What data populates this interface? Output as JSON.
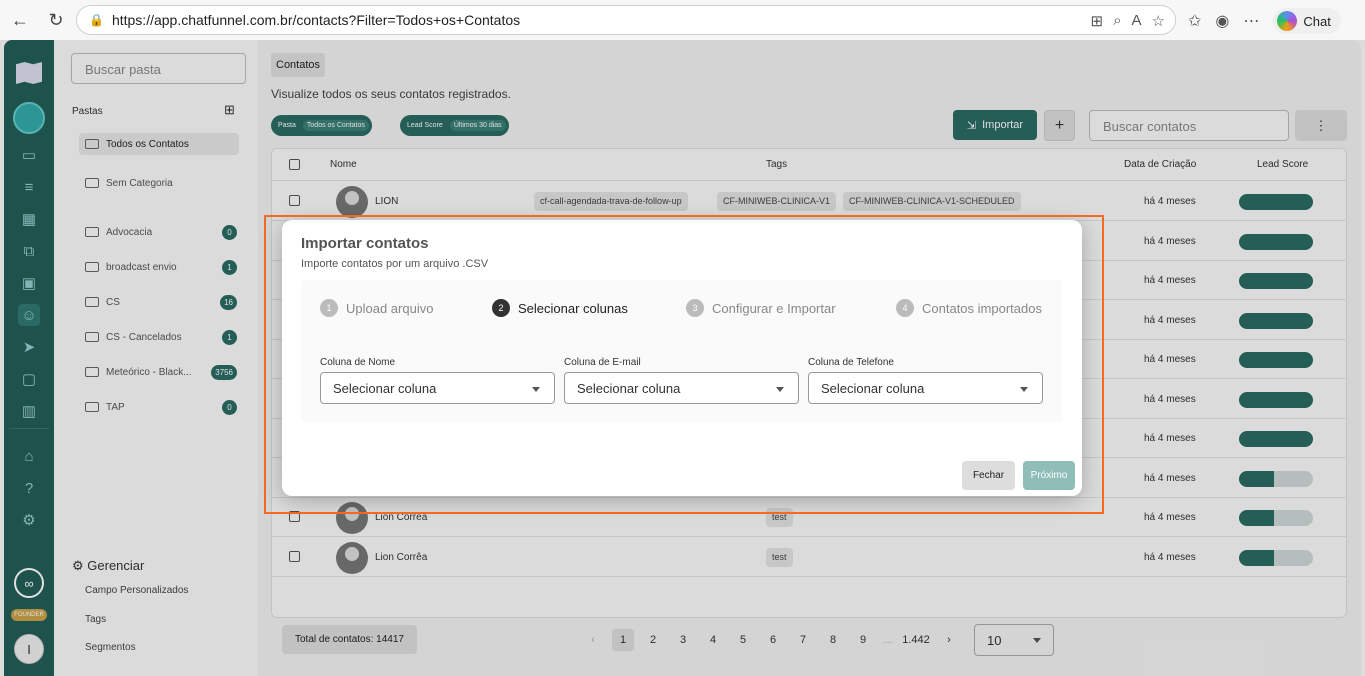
{
  "browser": {
    "url": "https://app.chatfunnel.com.br/contacts?Filter=Todos+os+Contatos",
    "chat_label": "Chat"
  },
  "folders": {
    "search_placeholder": "Buscar pasta",
    "section_label": "Pastas",
    "items": [
      {
        "label": "Todos os Contatos",
        "count": ""
      },
      {
        "label": "Sem Categoria",
        "count": ""
      },
      {
        "label": "Advocacia",
        "count": "0"
      },
      {
        "label": "broadcast envio",
        "count": "1"
      },
      {
        "label": "CS",
        "count": "16"
      },
      {
        "label": "CS - Cancelados",
        "count": "1"
      },
      {
        "label": "Meteórico - Black...",
        "count": "3756"
      },
      {
        "label": "TAP",
        "count": "0"
      }
    ],
    "manage_title": "Gerenciar",
    "manage_links": [
      "Campo Personalizados",
      "Tags",
      "Segmentos"
    ],
    "founder_badge": "FOUNDER",
    "user_initial": "I"
  },
  "main": {
    "page_title": "Contatos",
    "subtitle": "Visualize todos os seus contatos registrados.",
    "chips": [
      {
        "key": "Pasta",
        "value": "Todos os Contatos"
      },
      {
        "key": "Lead Score",
        "value": "Últimos 30 dias"
      }
    ],
    "import_label": "Importar",
    "plus_label": "+",
    "search_placeholder": "Buscar contatos",
    "kebab": "⋮",
    "columns": [
      "Nome",
      "Tags",
      "Data de Criação",
      "Lead Score"
    ],
    "rows": [
      {
        "name": "LION",
        "tags": [
          "cf-call-agendada-trava-de-follow-up",
          "CF-MINIWEB-CLINICA-V1",
          "CF-MINIWEB-CLINICA-V1-SCHEDULED"
        ],
        "date": "há 4 meses",
        "score": 1.0
      },
      {
        "name": "",
        "tags": [],
        "date": "há 4 meses",
        "score": 1.0
      },
      {
        "name": "",
        "tags": [],
        "date": "há 4 meses",
        "score": 1.0
      },
      {
        "name": "",
        "tags": [],
        "date": "há 4 meses",
        "score": 1.0
      },
      {
        "name": "",
        "tags": [],
        "date": "há 4 meses",
        "score": 1.0
      },
      {
        "name": "",
        "tags": [],
        "date": "há 4 meses",
        "score": 1.0
      },
      {
        "name": "",
        "tags": [],
        "date": "há 4 meses",
        "score": 1.0
      },
      {
        "name": "",
        "tags": [],
        "date": "há 4 meses",
        "score": 0.47
      },
      {
        "name": "Lion Corrêa",
        "tags": [
          "test"
        ],
        "date": "há 4 meses",
        "score": 0.47
      },
      {
        "name": "Lion Corrêa",
        "tags": [
          "test"
        ],
        "date": "há 4 meses",
        "score": 0.47
      }
    ],
    "total_label": "Total de contatos: 14417",
    "pages": [
      "1",
      "2",
      "3",
      "4",
      "5",
      "6",
      "7",
      "8",
      "9",
      "...",
      "1.442"
    ],
    "page_size": "10"
  },
  "modal": {
    "title": "Importar contatos",
    "subtitle": "Importe contatos por um arquivo .CSV",
    "steps": [
      {
        "num": "1",
        "label": "Upload arquivo"
      },
      {
        "num": "2",
        "label": "Selecionar colunas"
      },
      {
        "num": "3",
        "label": "Configurar e Importar"
      },
      {
        "num": "4",
        "label": "Contatos importados"
      }
    ],
    "fields": [
      {
        "label": "Coluna de Nome",
        "value": "Selecionar coluna"
      },
      {
        "label": "Coluna de E-mail",
        "value": "Selecionar coluna"
      },
      {
        "label": "Coluna de Telefone",
        "value": "Selecionar coluna"
      }
    ],
    "close_label": "Fechar",
    "next_label": "Próximo"
  },
  "colors": {
    "brand": "#2a6b64",
    "highlight": "#f36b21"
  }
}
